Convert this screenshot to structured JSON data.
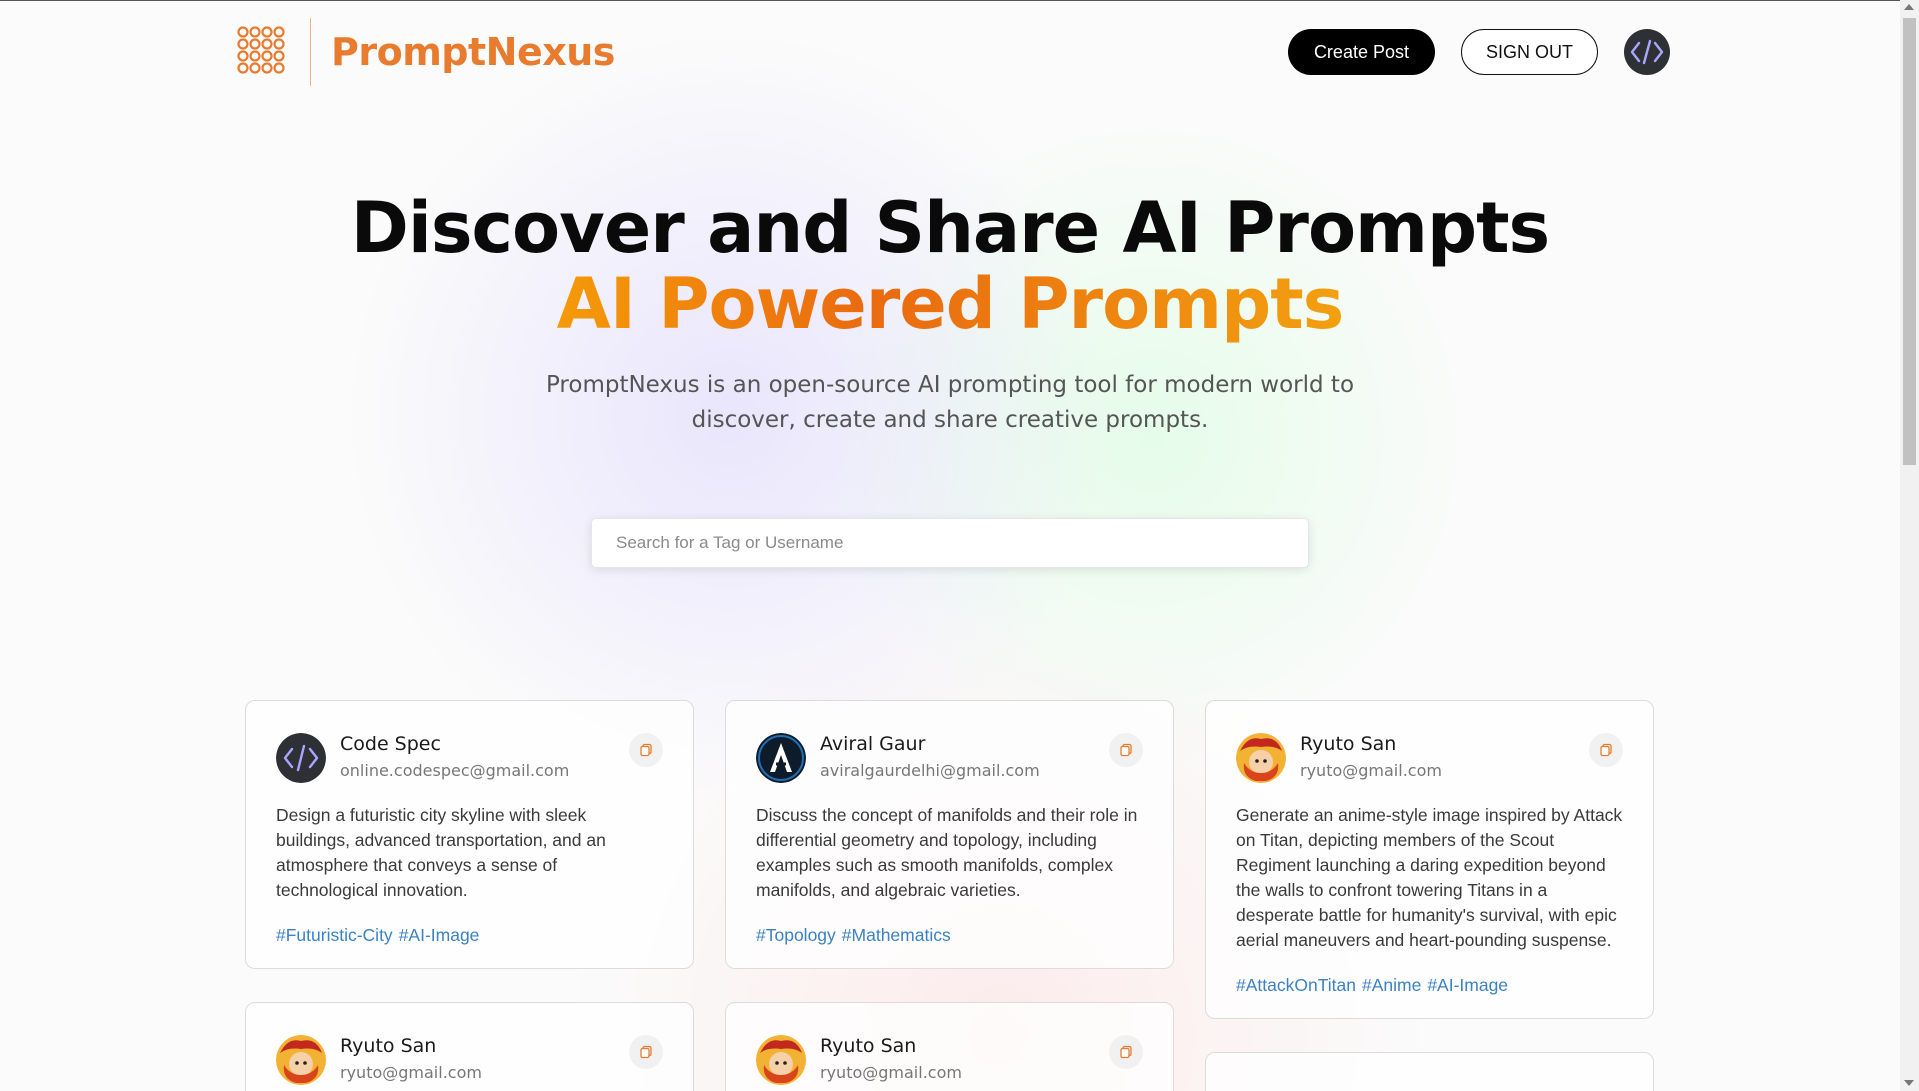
{
  "brand": {
    "name": "PromptNexus"
  },
  "nav": {
    "create_label": "Create Post",
    "signout_label": "SIGN OUT"
  },
  "hero": {
    "title": "Discover and Share AI Prompts",
    "accent": "AI Powered Prompts",
    "description": "PromptNexus is an open-source AI prompting tool for modern world to discover, create and share creative prompts."
  },
  "search": {
    "placeholder": "Search for a Tag or Username",
    "value": ""
  },
  "posts": [
    {
      "name": "Code Spec",
      "email": "online.codespec@gmail.com",
      "avatar": "code-icon",
      "text": "Design a futuristic city skyline with sleek buildings, advanced transportation, and an atmosphere that conveys a sense of technological innovation.",
      "tags": [
        "#Futuristic-City",
        "#AI-Image"
      ]
    },
    {
      "name": "Aviral Gaur",
      "email": "aviralgaurdelhi@gmail.com",
      "avatar": "letter-a-logo",
      "text": "Discuss the concept of manifolds and their role in differential geometry and topology, including examples such as smooth manifolds, complex manifolds, and algebraic varieties.",
      "tags": [
        "#Topology",
        "#Mathematics"
      ]
    },
    {
      "name": "Ryuto San",
      "email": "ryuto@gmail.com",
      "avatar": "anime-avatar",
      "text": "Generate an anime-style image inspired by Attack on Titan, depicting members of the Scout Regiment launching a daring expedition beyond the walls to confront towering Titans in a desperate battle for humanity's survival, with epic aerial maneuvers and heart-pounding suspense.",
      "tags": [
        "#AttackOnTitan",
        "#Anime",
        "#AI-Image"
      ]
    },
    {
      "name": "Ryuto San",
      "email": "ryuto@gmail.com",
      "avatar": "anime-avatar",
      "text": "",
      "tags": []
    },
    {
      "name": "Ryuto San",
      "email": "ryuto@gmail.com",
      "avatar": "anime-avatar",
      "text": "",
      "tags": []
    }
  ],
  "colors": {
    "brand": "#e87b2e",
    "tag": "#3b82c4",
    "accent_start": "#f59a08",
    "accent_end": "#ea6a10"
  }
}
